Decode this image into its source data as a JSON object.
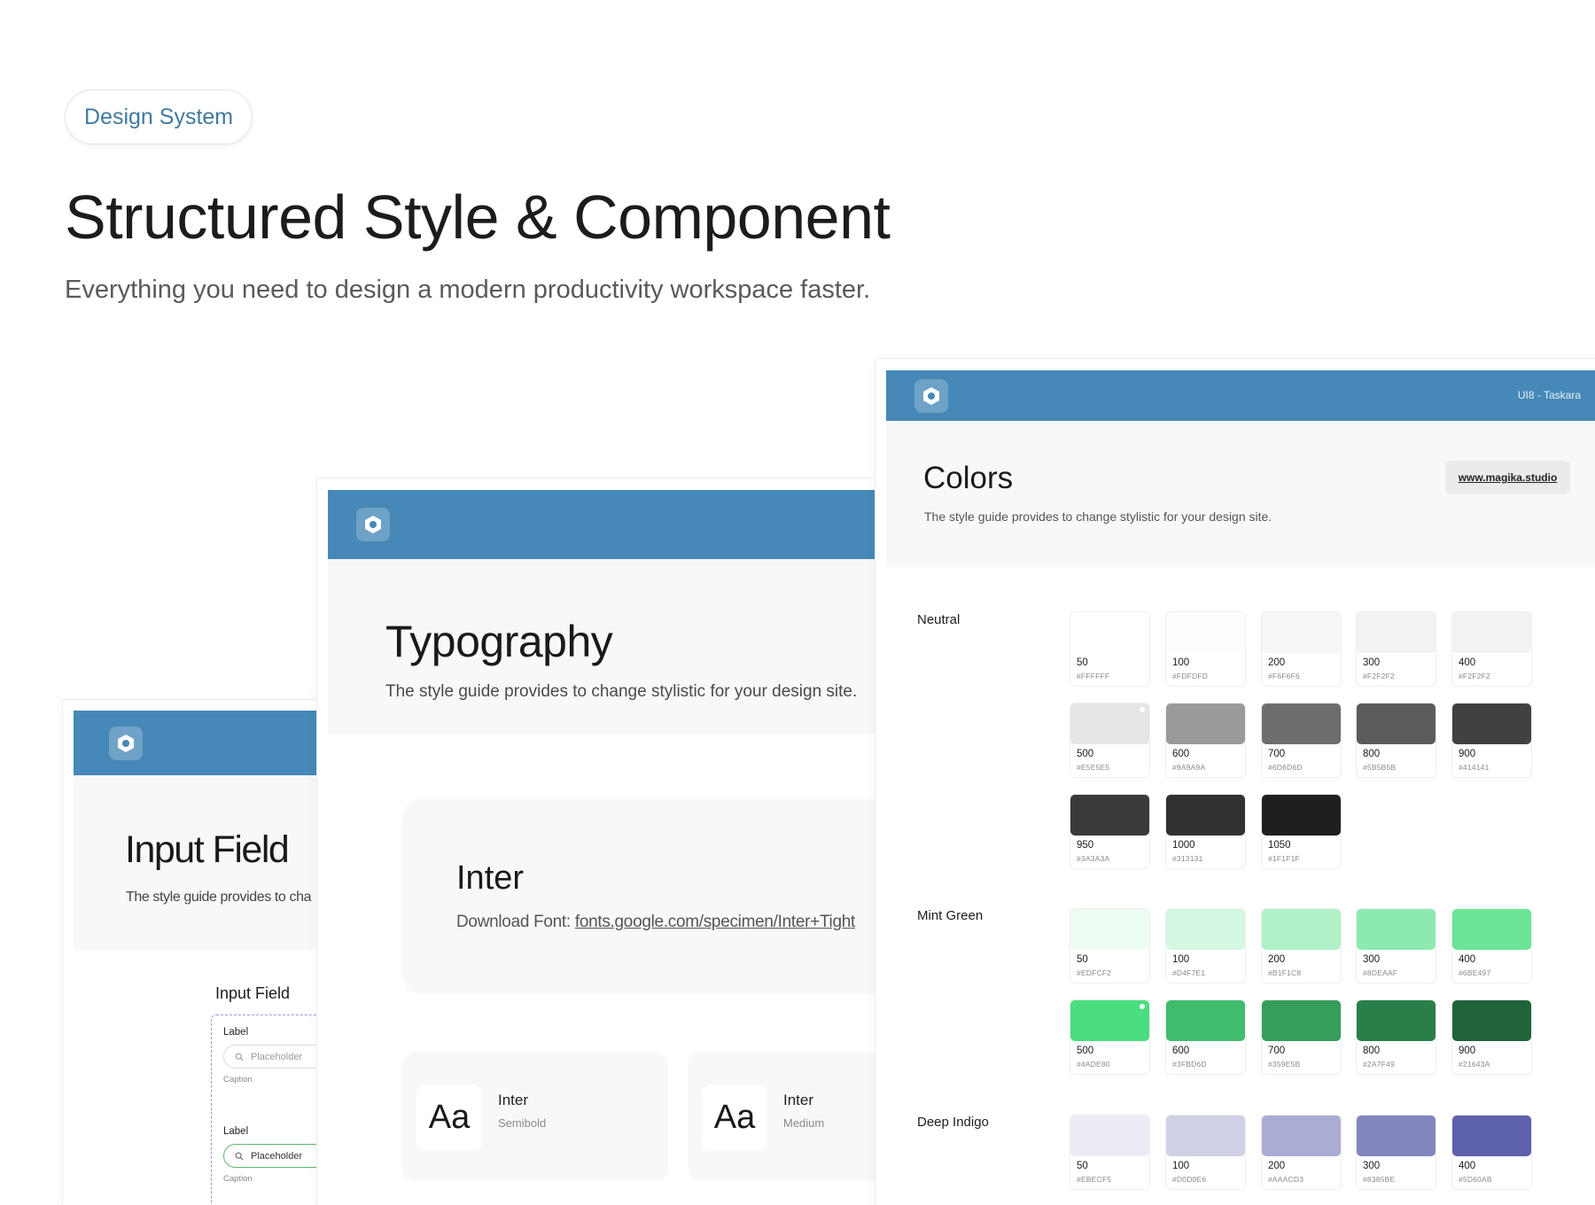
{
  "header": {
    "badge": "Design System",
    "title": "Structured Style & Component",
    "subtitle": "Everything you need to design a modern productivity workspace faster."
  },
  "input_card": {
    "title": "Input Field",
    "description": "The style guide provides to cha",
    "section_title": "Input Field",
    "fields": [
      {
        "label": "Label",
        "placeholder": "Placeholder",
        "caption": "Caption",
        "state": "default"
      },
      {
        "label": "Label",
        "placeholder": "Placeholder",
        "caption": "Caption",
        "state": "focus"
      }
    ]
  },
  "typography_card": {
    "title": "Typography",
    "description": "The style guide provides to change stylistic for your design site.",
    "font_name": "Inter",
    "download_label": "Download Font: ",
    "download_link": "fonts.google.com/specimen/Inter+Tight",
    "samples": [
      {
        "glyph": "Aa",
        "name": "Inter",
        "weight": "Semibold"
      },
      {
        "glyph": "Aa",
        "name": "Inter",
        "weight": "Medium"
      }
    ]
  },
  "colors_card": {
    "brand": "UI8 - Taskara",
    "title": "Colors",
    "description": "The style guide provides to change stylistic for your design site.",
    "link": "www.magika.studio",
    "groups": [
      {
        "name": "Neutral",
        "swatches": [
          {
            "name": "50",
            "hex": "#FFFFFF"
          },
          {
            "name": "100",
            "hex": "#FDFDFD"
          },
          {
            "name": "200",
            "hex": "#F6F6F6"
          },
          {
            "name": "300",
            "hex": "#F2F2F2"
          },
          {
            "name": "400",
            "hex": "#F2F2F2"
          },
          {
            "name": "500",
            "hex": "#E5E5E5",
            "selected": true
          },
          {
            "name": "600",
            "hex": "#9A9A9A"
          },
          {
            "name": "700",
            "hex": "#6D6D6D"
          },
          {
            "name": "800",
            "hex": "#5B5B5B"
          },
          {
            "name": "900",
            "hex": "#414141"
          },
          {
            "name": "950",
            "hex": "#3A3A3A"
          },
          {
            "name": "1000",
            "hex": "#313131"
          },
          {
            "name": "1050",
            "hex": "#1F1F1F"
          }
        ]
      },
      {
        "name": "Mint Green",
        "swatches": [
          {
            "name": "50",
            "hex": "#EDFCF2"
          },
          {
            "name": "100",
            "hex": "#D4F7E1"
          },
          {
            "name": "200",
            "hex": "#B1F1C8"
          },
          {
            "name": "300",
            "hex": "#8DEAAF"
          },
          {
            "name": "400",
            "hex": "#6BE497"
          },
          {
            "name": "500",
            "hex": "#4ADE80",
            "selected": true
          },
          {
            "name": "600",
            "hex": "#3FBD6D"
          },
          {
            "name": "700",
            "hex": "#359E5B"
          },
          {
            "name": "800",
            "hex": "#2A7F49"
          },
          {
            "name": "900",
            "hex": "#21643A"
          }
        ]
      },
      {
        "name": "Deep Indigo",
        "swatches": [
          {
            "name": "50",
            "hex": "#EBECF5"
          },
          {
            "name": "100",
            "hex": "#D0D0E6"
          },
          {
            "name": "200",
            "hex": "#AAACD3"
          },
          {
            "name": "300",
            "hex": "#8385BE"
          },
          {
            "name": "400",
            "hex": "#5D60AB"
          }
        ]
      }
    ]
  },
  "colors": {
    "accent_bar": "#4688B7",
    "badge_text": "#3F7AA0"
  },
  "icons": {
    "logo": "hexagon-ring-icon",
    "search": "search-icon"
  }
}
